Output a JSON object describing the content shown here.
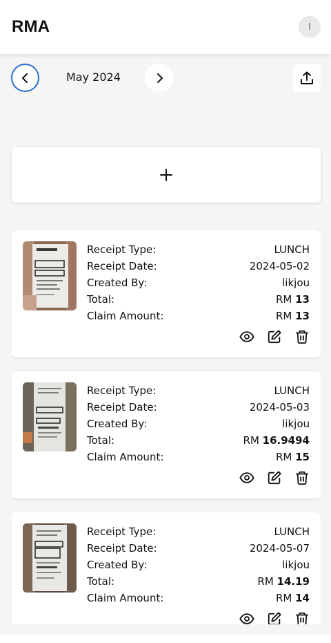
{
  "header": {
    "title": "RMA",
    "avatar_initial": "I"
  },
  "month_nav": {
    "current_month": "May 2024"
  },
  "icons": {
    "prev": "chevron-left-icon",
    "next": "chevron-right-icon",
    "export": "upload-icon",
    "add": "plus-icon",
    "view": "eye-icon",
    "edit": "edit-icon",
    "delete": "trash-icon"
  },
  "labels": {
    "receipt_type": "Receipt Type:",
    "receipt_date": "Receipt Date:",
    "created_by": "Created By:",
    "total": "Total:",
    "claim_amount": "Claim Amount:",
    "currency": "RM"
  },
  "receipts": [
    {
      "type": "LUNCH",
      "date": "2024-05-02",
      "created_by": "likjou",
      "total": "13",
      "claim": "13"
    },
    {
      "type": "LUNCH",
      "date": "2024-05-03",
      "created_by": "likjou",
      "total": "16.9494",
      "claim": "15"
    },
    {
      "type": "LUNCH",
      "date": "2024-05-07",
      "created_by": "likjou",
      "total": "14.19",
      "claim": "14"
    }
  ],
  "colors": {
    "accent": "#2a6fd1",
    "background": "#f5f5f6"
  }
}
